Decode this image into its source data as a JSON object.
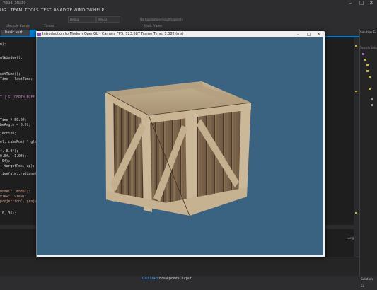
{
  "ide": {
    "title": "Visual Studio",
    "menu": [
      "UG",
      "TEAM",
      "TOOLS",
      "TEST",
      "ANALYZE",
      "WINDOW",
      "HELP"
    ],
    "toolbar": {
      "config": "Debug",
      "platform": "Win32",
      "app_insights": "No Application Insights Events",
      "process": "Lifecycle Events",
      "thread": "Thread",
      "stack_frame": "Stack Frame"
    },
    "tab": "basic.vert",
    "code_lines": [
      "m);",
      "",
      "glWindow();",
      "",
      "",
      "netTime();",
      "Time - lastTime;",
      "",
      "",
      "T | GL_DEPTH_BUFF",
      "",
      "",
      "",
      "Time * 50.0f;",
      "beAngle = 0.0f;",
      "",
      "jection;",
      "",
      "el, cubePos) * glm",
      "",
      "f, 0.0f);",
      "0.0f, -1.0f);",
      ".0f);",
      ", targetPos, up);",
      "",
      "tive(glm::radians(4",
      "",
      "",
      "",
      "model\", model);",
      "view\", view);",
      "projection\", proje",
      "",
      "",
      " 0, 36);"
    ],
    "solution_header": "Solution Ex",
    "solution_search": "Search Solu",
    "solution_footer": "Solution Ex",
    "lang": "Lang",
    "bottom_tabs": [
      "Call Stack",
      "Breakpoints",
      "Output"
    ]
  },
  "gl_window": {
    "title": "Introduction to Modern OpenGL - Camera   FPS: 723.587   Frame Time: 1.382 (ms)",
    "controls": [
      "–",
      "□",
      "✕"
    ],
    "clear_color": "#3a6382"
  },
  "colors": {
    "accent": "#007acc",
    "editor_bg": "#1e1e1e",
    "ide_bg": "#2d2d30"
  }
}
